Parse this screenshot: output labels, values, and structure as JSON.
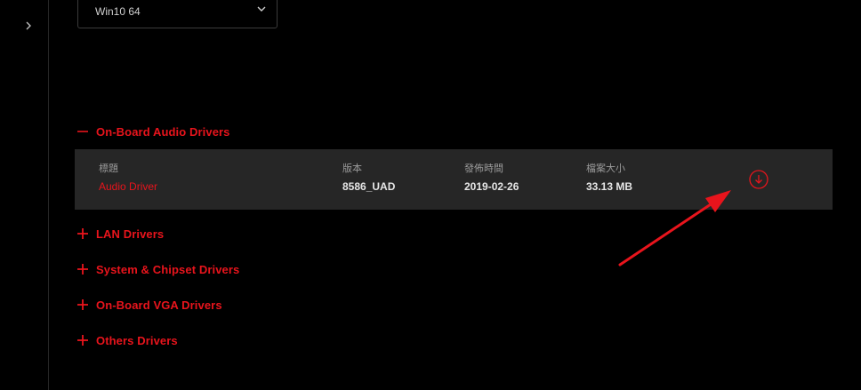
{
  "os_select": {
    "value": "Win10 64",
    "icon": "chevron-down-icon"
  },
  "sidebar": {
    "toggle_icon": "chevron-right-icon"
  },
  "sections": {
    "audio": {
      "label": "On-Board Audio Drivers",
      "state": "expanded",
      "icon": "minus-icon"
    },
    "lan": {
      "label": "LAN Drivers",
      "state": "collapsed",
      "icon": "plus-icon"
    },
    "chipset": {
      "label": "System & Chipset Drivers",
      "state": "collapsed",
      "icon": "plus-icon"
    },
    "vga": {
      "label": "On-Board VGA Drivers",
      "state": "collapsed",
      "icon": "plus-icon"
    },
    "others": {
      "label": "Others Drivers",
      "state": "collapsed",
      "icon": "plus-icon"
    }
  },
  "driver_table": {
    "headers": {
      "title": "標題",
      "version": "版本",
      "release_date": "發佈時間",
      "file_size": "檔案大小"
    },
    "rows": [
      {
        "title": "Audio Driver",
        "version": "8586_UAD",
        "release_date": "2019-02-26",
        "file_size": "33.13 MB",
        "action_icon": "download-icon"
      }
    ]
  },
  "colors": {
    "accent": "#e8141c",
    "annotation": "#e8141c",
    "background": "#000000",
    "row_background": "#262626"
  }
}
